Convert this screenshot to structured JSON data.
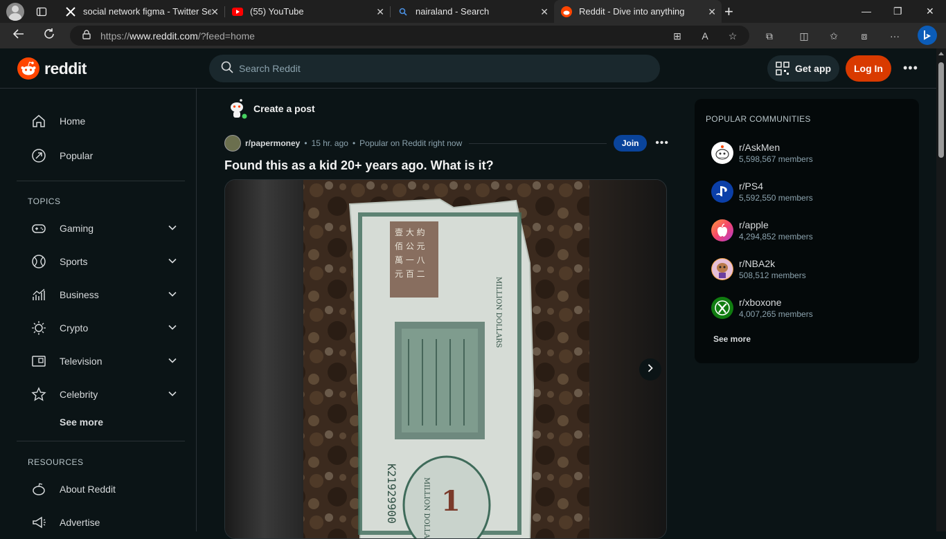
{
  "browser": {
    "tabs": [
      {
        "title": "social network figma - Twitter Se",
        "icon": "x-logo-icon"
      },
      {
        "title": "(55) YouTube",
        "icon": "youtube-icon"
      },
      {
        "title": "nairaland - Search",
        "icon": "search-icon"
      },
      {
        "title": "Reddit - Dive into anything",
        "icon": "reddit-icon"
      }
    ],
    "url_scheme": "https://",
    "url_host": "www.reddit.com",
    "url_path": "/?feed=home"
  },
  "header": {
    "logo_text": "reddit",
    "search_placeholder": "Search Reddit",
    "get_app": "Get app",
    "login": "Log In"
  },
  "left_nav": {
    "main": [
      {
        "label": "Home",
        "icon": "home-icon"
      },
      {
        "label": "Popular",
        "icon": "popular-icon"
      }
    ],
    "topics_label": "TOPICS",
    "topics": [
      {
        "label": "Gaming",
        "icon": "gamepad-icon"
      },
      {
        "label": "Sports",
        "icon": "ball-icon"
      },
      {
        "label": "Business",
        "icon": "chart-icon"
      },
      {
        "label": "Crypto",
        "icon": "crypto-icon"
      },
      {
        "label": "Television",
        "icon": "tv-icon"
      },
      {
        "label": "Celebrity",
        "icon": "star-icon"
      }
    ],
    "see_more": "See more",
    "resources_label": "RESOURCES",
    "resources": [
      {
        "label": "About Reddit",
        "icon": "about-icon"
      },
      {
        "label": "Advertise",
        "icon": "megaphone-icon"
      }
    ]
  },
  "feed": {
    "create_post": "Create a post",
    "post": {
      "subreddit": "r/papermoney",
      "time": "15 hr. ago",
      "tag": "Popular on Reddit right now",
      "join": "Join",
      "title": "Found this as a kid 20+ years ago. What is it?",
      "image": {
        "serial": "K21929900",
        "denomination": "1",
        "label_top": "MILLION DOLLARS",
        "label_bottom": "MILLION DOLLARS"
      }
    }
  },
  "right_sidebar": {
    "title": "POPULAR COMMUNITIES",
    "communities": [
      {
        "name": "r/AskMen",
        "members": "5,598,567 members",
        "color": "#ffffff"
      },
      {
        "name": "r/PS4",
        "members": "5,592,550 members",
        "color": "#0b3fa8"
      },
      {
        "name": "r/apple",
        "members": "4,294,852 members",
        "color": "#f5456b"
      },
      {
        "name": "r/NBA2k",
        "members": "508,512 members",
        "color": "#f2a03f"
      },
      {
        "name": "r/xboxone",
        "members": "4,007,265 members",
        "color": "#107c10"
      }
    ],
    "see_more": "See more"
  },
  "colors": {
    "background": "#0b1416",
    "accent": "#ff4500",
    "login": "#d93a00",
    "join": "#0a449b"
  }
}
